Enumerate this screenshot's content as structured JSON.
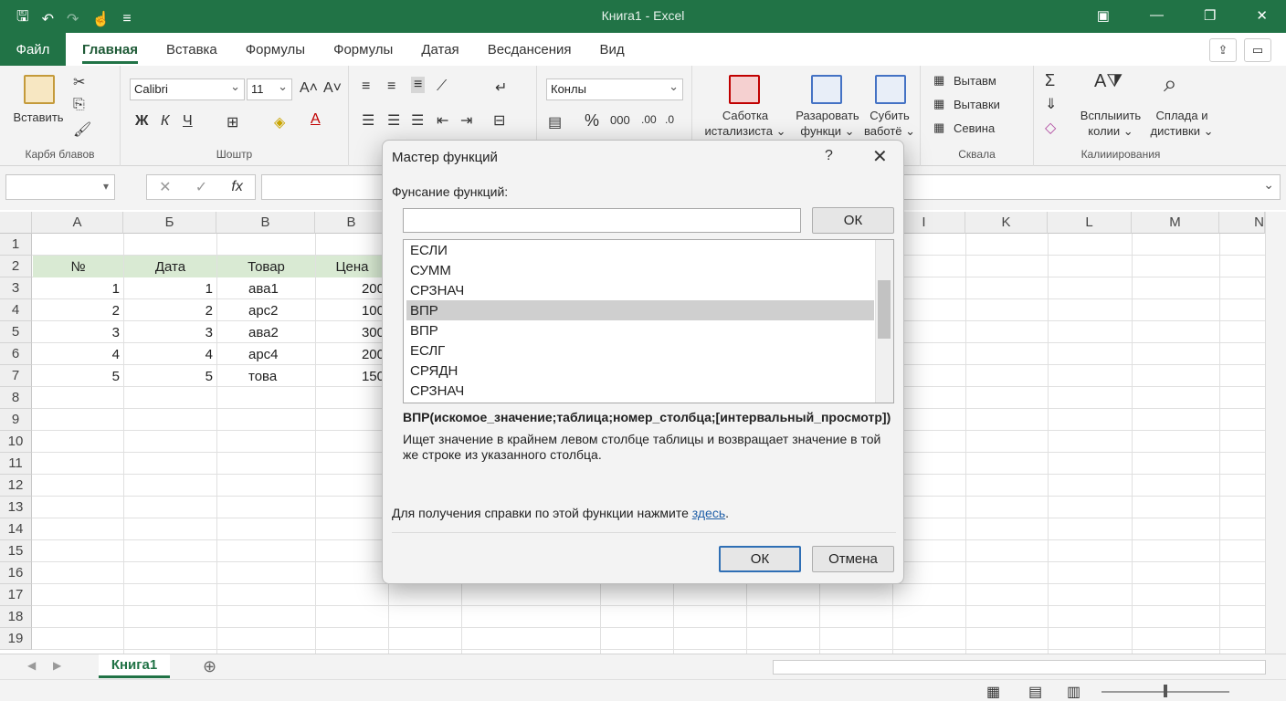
{
  "window": {
    "title": "Книга1 - Excel",
    "qat_icons": [
      "save-icon",
      "undo-icon",
      "redo-icon",
      "touch-icon",
      "customize-icon"
    ]
  },
  "tabs": {
    "file": "Файл",
    "items": [
      "Главная",
      "Вставка",
      "Формулы",
      "Формулы",
      "Датая",
      "Весдансения",
      "Вид"
    ],
    "active_index": 0
  },
  "ribbon": {
    "clipboard": {
      "paste_label": "Вставить",
      "group_label": "Карбя блавов"
    },
    "font": {
      "font_name": "Calibri",
      "font_size": "11",
      "group_label": "Шоштр"
    },
    "number": {
      "format": "Конлы"
    },
    "styles": {
      "b1": "Саботка",
      "b1b": "истализиста",
      "b2": "Разаровать",
      "b2b": "функци",
      "b3": "Субить",
      "b3b": "ваботё"
    },
    "cells": {
      "insert": "Вытавм",
      "delete": "Вытавки",
      "format": "Севина",
      "group_label": "Сквала"
    },
    "editing": {
      "b1": "Всплыиить",
      "b1b": "колии",
      "b2": "Сплада и",
      "b2b": "дистивки",
      "group_label": "Калииирования"
    }
  },
  "grid": {
    "columns": [
      "A",
      "Б",
      "В",
      "В",
      "",
      "",
      "",
      "",
      "I",
      "K",
      "L",
      "M",
      "N"
    ],
    "rows": [
      "1",
      "2",
      "3",
      "4",
      "5",
      "6",
      "7",
      "8",
      "9",
      "10",
      "11",
      "12",
      "13",
      "14",
      "15",
      "16",
      "17",
      "18",
      "19"
    ],
    "headers": [
      "№",
      "Дата",
      "Товар",
      "Цена"
    ],
    "data": [
      [
        "1",
        "1",
        "ава1",
        "200"
      ],
      [
        "2",
        "2",
        "арс2",
        "100"
      ],
      [
        "3",
        "3",
        "ава2",
        "300"
      ],
      [
        "4",
        "4",
        "арс4",
        "200"
      ],
      [
        "5",
        "5",
        "това",
        "150"
      ]
    ]
  },
  "sheets": {
    "active": "Книга1"
  },
  "dialog": {
    "title": "Мастер функций",
    "help": "?",
    "search_label": "Фунсание функций:",
    "search_value": "",
    "search_ok": "ОК",
    "functions": [
      "ЕСЛИ",
      "СУММ",
      "СРЗНАЧ",
      "ВПР",
      "ВПР",
      "ЕСЛГ",
      "СРЯДН",
      "СРЗНАЧ"
    ],
    "selected_index": 3,
    "syntax": "ВПР(искомое_значение;таблица;номер_столбца;[интервальный_просмотр])",
    "description": "Ищет значение в крайнем левом столбце таблицы и возвращает значение в той же строке из указанного столбца.",
    "help_text": "Для получения справки по этой функции нажмите ",
    "help_link": "здесь",
    "help_end": ".",
    "ok": "ОК",
    "cancel": "Отмена"
  }
}
